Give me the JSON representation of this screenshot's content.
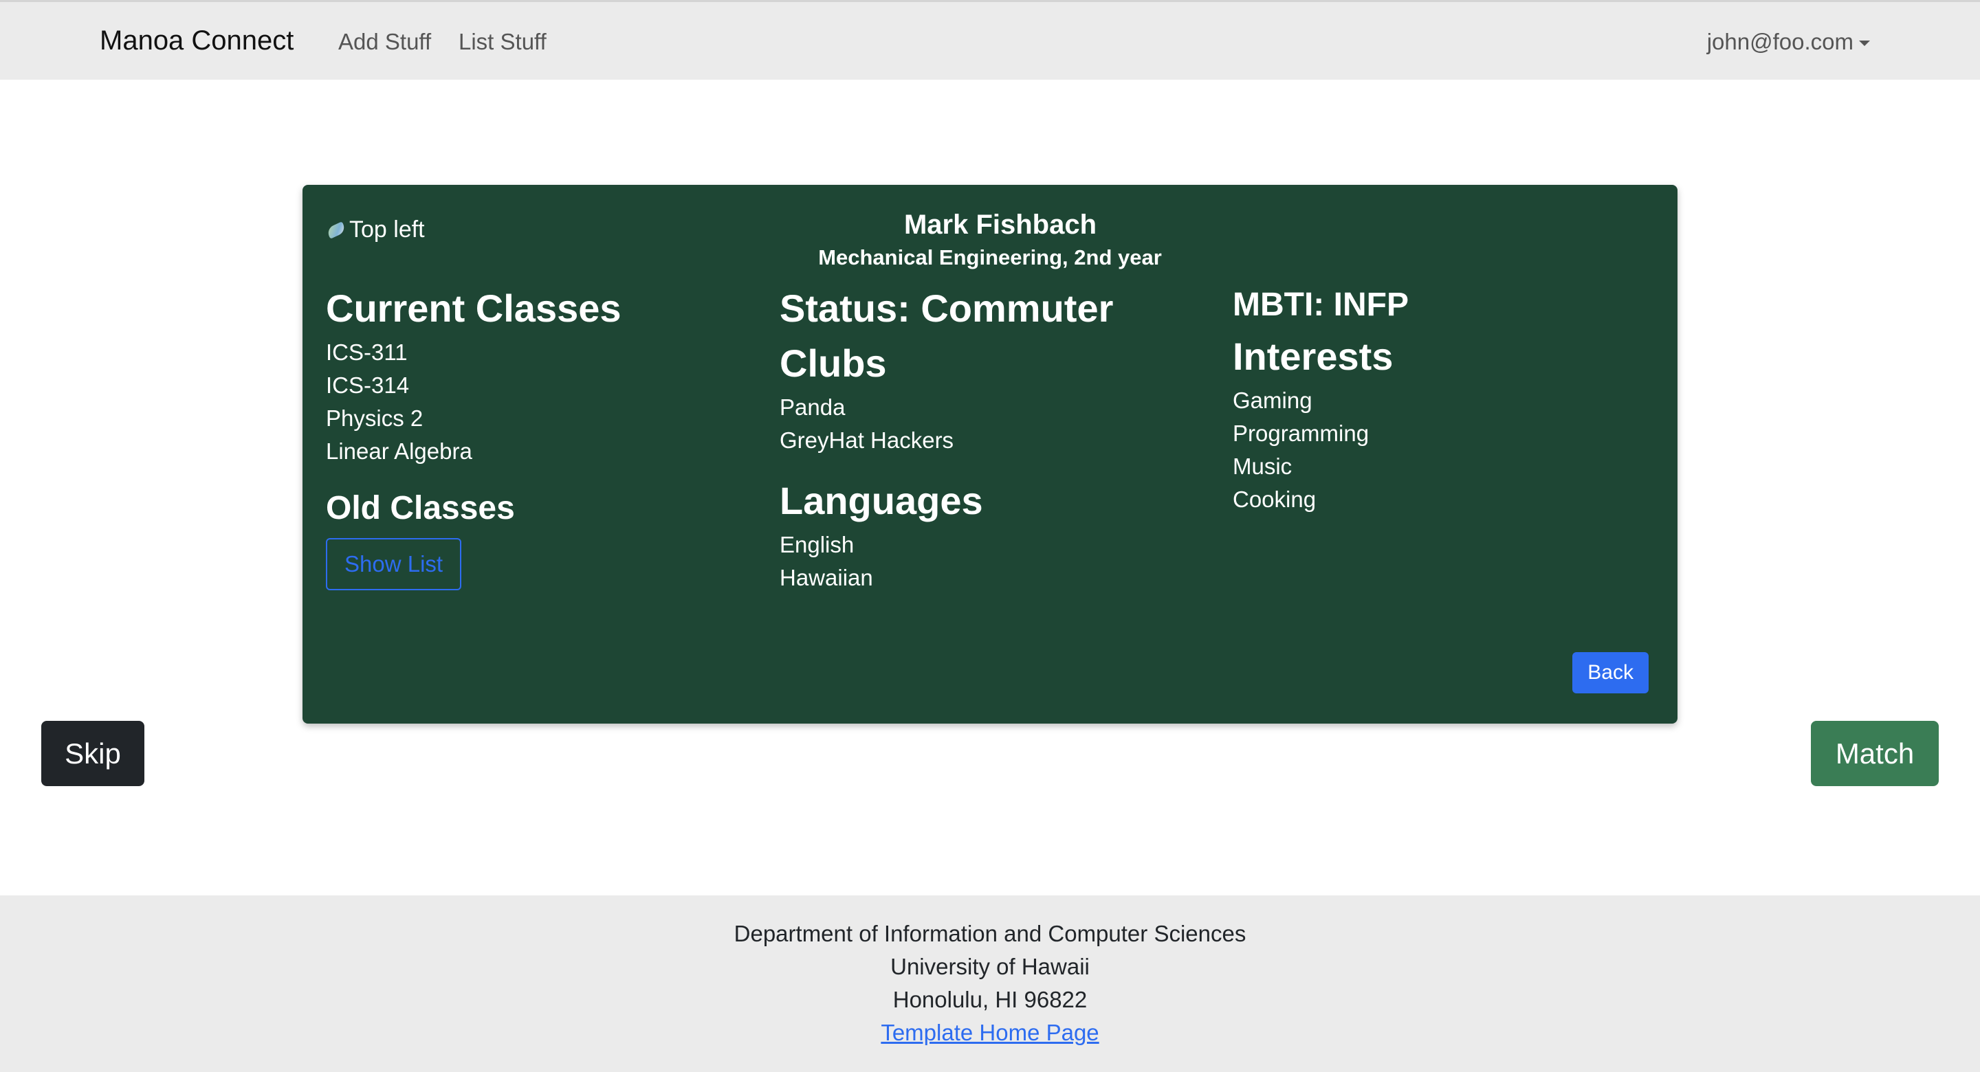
{
  "navbar": {
    "brand": "Manoa Connect",
    "links": [
      "Add Stuff",
      "List Stuff"
    ],
    "user": "john@foo.com"
  },
  "profile": {
    "image_alt": "Top left",
    "name": "Mark Fishbach",
    "subtitle": "Mechanical Engineering, 2nd year",
    "current_classes_heading": "Current Classes",
    "current_classes": [
      "ICS-311",
      "ICS-314",
      "Physics 2",
      "Linear Algebra"
    ],
    "old_classes_heading": "Old Classes",
    "show_list_label": "Show List",
    "status": "Status: Commuter",
    "clubs_heading": "Clubs",
    "clubs": [
      "Panda",
      "GreyHat Hackers"
    ],
    "languages_heading": "Languages",
    "languages": [
      "English",
      "Hawaiian"
    ],
    "mbti": "MBTI: INFP",
    "interests_heading": "Interests",
    "interests": [
      "Gaming",
      "Programming",
      "Music",
      "Cooking"
    ],
    "back_label": "Back"
  },
  "actions": {
    "skip_label": "Skip",
    "match_label": "Match"
  },
  "footer": {
    "line1": "Department of Information and Computer Sciences",
    "line2": "University of Hawaii",
    "line3": "Honolulu, HI 96822",
    "link": "Template Home Page"
  }
}
